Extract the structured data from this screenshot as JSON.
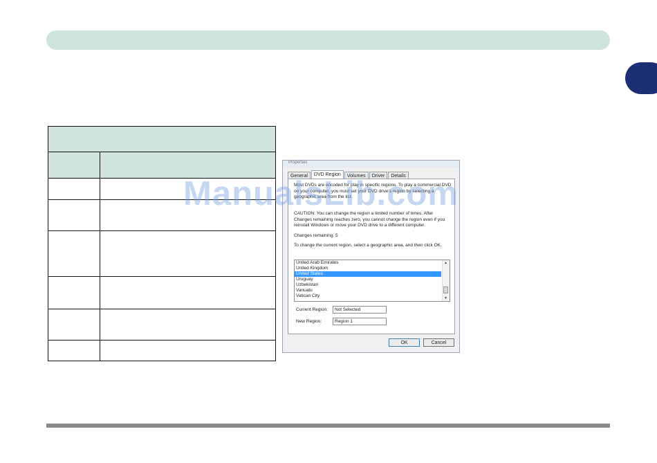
{
  "dialog": {
    "title": "Properties",
    "tabs": [
      "General",
      "DVD Region",
      "Volumes",
      "Driver",
      "Details"
    ],
    "intro": "Most DVDs are encoded for play in specific regions. To play a commercial DVD on your computer, you must set your DVD drive's region by selecting a geographic area from the list.",
    "caution": "CAUTION: You can change the region a limited number of times. After Changes remaining reaches zero, you cannot change the region even if you reinstall Windows or move your DVD drive to a different computer.",
    "changes_remaining": "Changes remaining: 5",
    "instruction": "To change the current region, select a geographic area, and then click OK.",
    "list_items": [
      "United Arab Emirates",
      "United Kingdom",
      "United States",
      "Uruguay",
      "Uzbekistan",
      "Vanuatu",
      "Vatican City"
    ],
    "selected_index": 2,
    "current_region_label": "Current Region:",
    "current_region_value": "Not Selected",
    "new_region_label": "New Region:",
    "new_region_value": "Region 1",
    "ok_label": "OK",
    "cancel_label": "Cancel"
  },
  "watermark": "ManualsLib.com"
}
